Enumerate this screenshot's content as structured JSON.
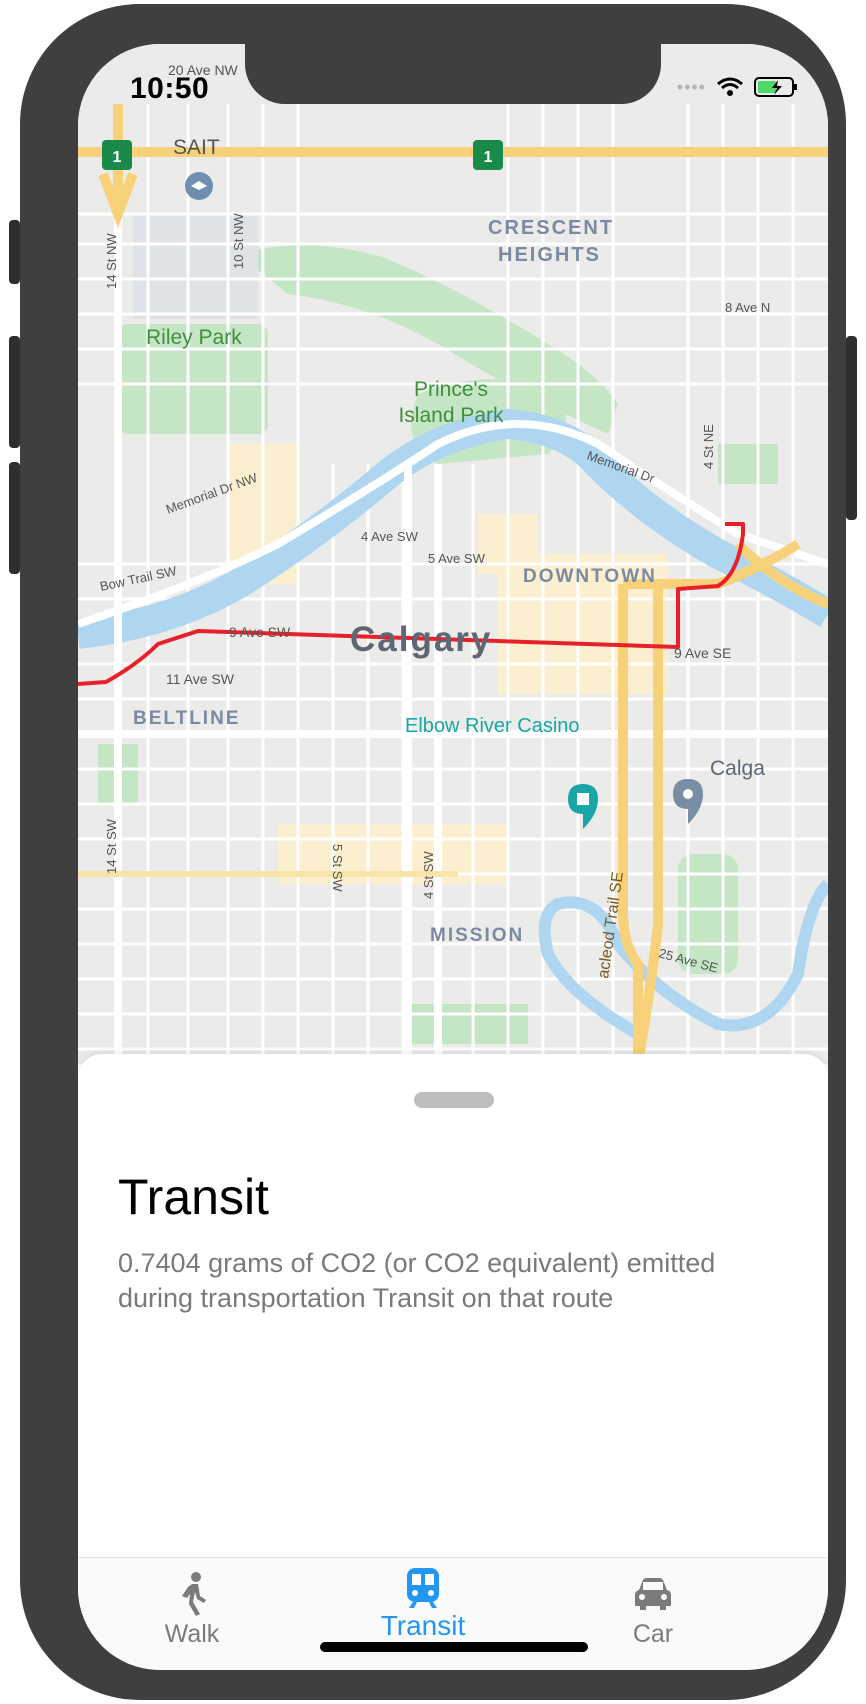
{
  "status_bar": {
    "time": "10:50"
  },
  "map": {
    "city_label": "Calgary",
    "neighborhoods": [
      "CRESCENT",
      "HEIGHTS",
      "DOWNTOWN",
      "BELTLINE",
      "MISSION"
    ],
    "places": {
      "sait": "SAIT",
      "riley_park": "Riley Park",
      "princes_line1": "Prince's",
      "princes_line2": "Island Park",
      "casino": "Elbow River Casino",
      "calgary_pin": "Calga"
    },
    "streets": {
      "ave20nw": "20 Ave NW",
      "st14nw": "14 St NW",
      "st10nw": "10 St NW",
      "ave8ne": "8 Ave N",
      "st4ne": "4 St NE",
      "memorial_nw": "Memorial Dr NW",
      "memorial": "Memorial Dr",
      "ave4sw": "4 Ave SW",
      "ave5sw": "5 Ave SW",
      "bow_trail": "Bow Trail SW",
      "ave9sw": "9 Ave SW",
      "ave9se": "9 Ave SE",
      "ave11sw": "11 Ave SW",
      "st14sw": "14 St SW",
      "st5sw": "5 St SW",
      "st4sw": "4 St SW",
      "macleod": "acleod Trail SE",
      "ave25se": "25 Ave SE"
    },
    "highway_shield": "1",
    "route_color": "#e8202a"
  },
  "sheet": {
    "title": "Transit",
    "description": "0.7404 grams of CO2 (or CO2 equivalent) emitted during transportation Transit on that route"
  },
  "tabs": [
    {
      "label": "Walk",
      "icon": "walk-icon",
      "active": false
    },
    {
      "label": "Transit",
      "icon": "train-icon",
      "active": true
    },
    {
      "label": "Car",
      "icon": "car-icon",
      "active": false
    }
  ],
  "colors": {
    "accent": "#2196f3",
    "inactive": "#7b7b7b"
  }
}
